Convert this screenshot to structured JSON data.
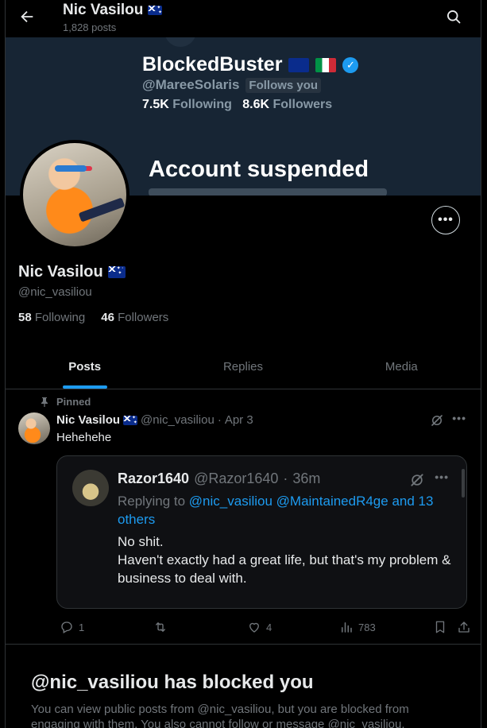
{
  "header": {
    "title": "Nic Vasilou",
    "posts_count": "1,828 posts"
  },
  "banner": {
    "name": "BlockedBuster",
    "handle": "@MareeSolaris",
    "follows_badge": "Follows you",
    "following_count": "7.5K",
    "following_label": "Following",
    "followers_count": "8.6K",
    "followers_label": "Followers",
    "status": "Account suspended"
  },
  "profile": {
    "name": "Nic Vasilou",
    "handle": "@nic_vasiliou",
    "following_count": "58",
    "following_label": "Following",
    "followers_count": "46",
    "followers_label": "Followers"
  },
  "tabs": [
    {
      "label": "Posts",
      "active": true
    },
    {
      "label": "Replies",
      "active": false
    },
    {
      "label": "Media",
      "active": false
    }
  ],
  "post": {
    "pinned_label": "Pinned",
    "author_name": "Nic Vasilou",
    "author_handle": "@nic_vasiliou",
    "separator": "·",
    "date": "Apr 3",
    "text": "Hehehehe",
    "quote": {
      "author_name": "Razor1640",
      "author_handle": "@Razor1640",
      "separator": "·",
      "time": "36m",
      "replying_prefix": "Replying to",
      "replying_links": "@nic_vasiliou @MaintainedR4ge and 13 others",
      "line1": "No shit.",
      "line2": "Haven't exactly had a great life, but that's my problem & business to deal with."
    },
    "actions": {
      "replies": "1",
      "reposts": "",
      "likes": "4",
      "views": "783"
    }
  },
  "blocked": {
    "title": "@nic_vasiliou has blocked you",
    "text": "You can view public posts from @nic_vasiliou, but you are blocked from engaging with them. You also cannot follow or message @nic_vasiliou."
  },
  "icons": {
    "back": "arrow-left-icon",
    "search": "search-icon",
    "more": "more-horizontal-icon",
    "pin": "pin-icon",
    "grok": "grok-icon",
    "reply": "reply-icon",
    "repost": "repost-icon",
    "like": "heart-icon",
    "views": "views-icon",
    "bookmark": "bookmark-icon",
    "share": "share-icon"
  },
  "colors": {
    "accent": "#1d9bf0",
    "muted": "#71767b",
    "text": "#e7e9ea",
    "background": "#000000"
  }
}
